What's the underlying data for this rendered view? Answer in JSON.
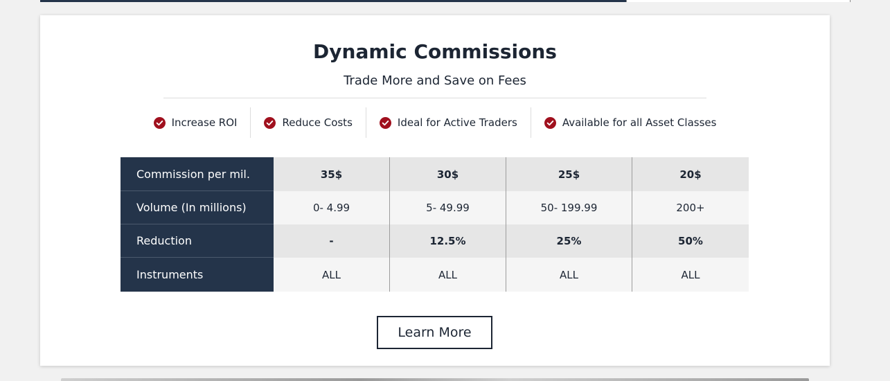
{
  "section": {
    "title": "Dynamic Commissions",
    "subtitle": "Trade More and Save on Fees"
  },
  "features": [
    {
      "label": "Increase ROI",
      "icon": "check-circle-icon"
    },
    {
      "label": "Reduce Costs",
      "icon": "check-circle-icon"
    },
    {
      "label": "Ideal for Active Traders",
      "icon": "check-circle-icon"
    },
    {
      "label": "Available for all Asset Classes",
      "icon": "check-circle-icon"
    }
  ],
  "table": {
    "rows": [
      {
        "header": "Commission per mil.",
        "values": [
          "35$",
          "30$",
          "25$",
          "20$"
        ]
      },
      {
        "header": "Volume (In millions)",
        "values": [
          "0- 4.99",
          "5- 49.99",
          "50- 199.99",
          "200+"
        ]
      },
      {
        "header": "Reduction",
        "values": [
          "-",
          "12.5%",
          "25%",
          "50%"
        ]
      },
      {
        "header": "Instruments",
        "values": [
          "ALL",
          "ALL",
          "ALL",
          "ALL"
        ]
      }
    ]
  },
  "cta": {
    "label": "Learn More"
  },
  "colors": {
    "accent": "#a0101e",
    "header_bg": "#24344a",
    "text": "#1c2533"
  }
}
